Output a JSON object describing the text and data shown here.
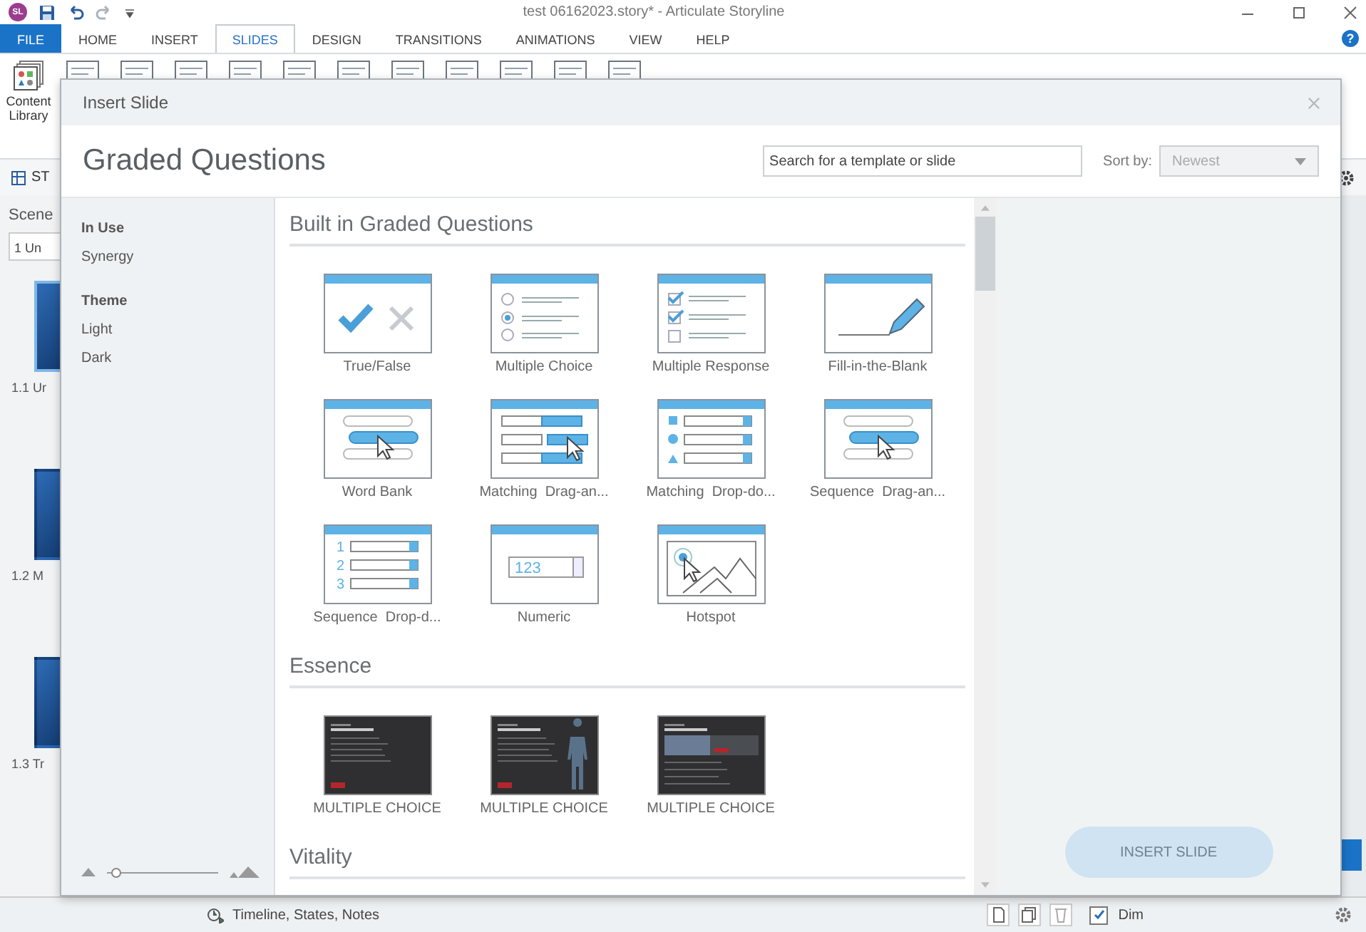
{
  "app": {
    "logo": "SL",
    "title": "test 06162023.story* - Articulate Storyline",
    "help": "?",
    "ribbon_tabs": [
      {
        "label": "FILE",
        "kind": "file",
        "selected": false
      },
      {
        "label": "HOME",
        "kind": "tab",
        "selected": false
      },
      {
        "label": "INSERT",
        "kind": "tab",
        "selected": false
      },
      {
        "label": "SLIDES",
        "kind": "tab",
        "selected": true
      },
      {
        "label": "DESIGN",
        "kind": "tab",
        "selected": false
      },
      {
        "label": "TRANSITIONS",
        "kind": "tab",
        "selected": false
      },
      {
        "label": "ANIMATIONS",
        "kind": "tab",
        "selected": false
      },
      {
        "label": "VIEW",
        "kind": "tab",
        "selected": false
      },
      {
        "label": "HELP",
        "kind": "tab",
        "selected": false
      }
    ],
    "content_library": "Content Library",
    "view_tab": "ST",
    "scenes": {
      "heading": "Scene",
      "dropdown": "1 Un",
      "slides": [
        {
          "label": "1.1 Ur",
          "selected": true
        },
        {
          "label": "1.2 M",
          "selected": false
        },
        {
          "label": "1.3 Tr",
          "selected": false
        }
      ]
    },
    "bottom_bar": {
      "label": "Timeline, States, Notes"
    },
    "dim": {
      "label": "Dim",
      "checked": true
    }
  },
  "dialog": {
    "title": "Insert Slide",
    "heading": "Graded Questions",
    "search": {
      "placeholder": "Search for a template or slide"
    },
    "sort": {
      "label": "Sort by:",
      "value": "Newest",
      "disabled": true
    },
    "sidebar": [
      {
        "heading": "In Use",
        "items": [
          "Synergy"
        ]
      },
      {
        "heading": "Theme",
        "items": [
          "Light",
          "Dark"
        ]
      }
    ],
    "zoom": {
      "level": 0.08
    },
    "sections": [
      {
        "title": "Built in Graded Questions",
        "items": [
          {
            "label": "True/False",
            "kind": "true_false"
          },
          {
            "label": "Multiple Choice",
            "kind": "multiple_choice"
          },
          {
            "label": "Multiple Response",
            "kind": "multiple_response"
          },
          {
            "label": "Fill-in-the-Blank",
            "kind": "fill_blank"
          },
          {
            "label": "Word Bank",
            "kind": "word_bank"
          },
          {
            "label": "Matching  Drag-an...",
            "kind": "matching_drag"
          },
          {
            "label": "Matching  Drop-do...",
            "kind": "matching_dropdown"
          },
          {
            "label": "Sequence  Drag-an...",
            "kind": "sequence_drag"
          },
          {
            "label": "Sequence  Drop-d...",
            "kind": "sequence_dropdown",
            "icon_text": [
              "1",
              "2",
              "3"
            ]
          },
          {
            "label": "Numeric",
            "kind": "numeric",
            "icon_text": [
              "123"
            ]
          },
          {
            "label": "Hotspot",
            "kind": "hotspot"
          }
        ]
      },
      {
        "title": "Essence",
        "items": [
          {
            "label": "MULTIPLE CHOICE",
            "kind": "slide"
          },
          {
            "label": "MULTIPLE CHOICE",
            "kind": "slide_figure"
          },
          {
            "label": "MULTIPLE CHOICE",
            "kind": "slide_photo"
          }
        ]
      },
      {
        "title": "Vitality"
      }
    ],
    "insert_button": {
      "label": "INSERT SLIDE",
      "disabled": true
    }
  }
}
